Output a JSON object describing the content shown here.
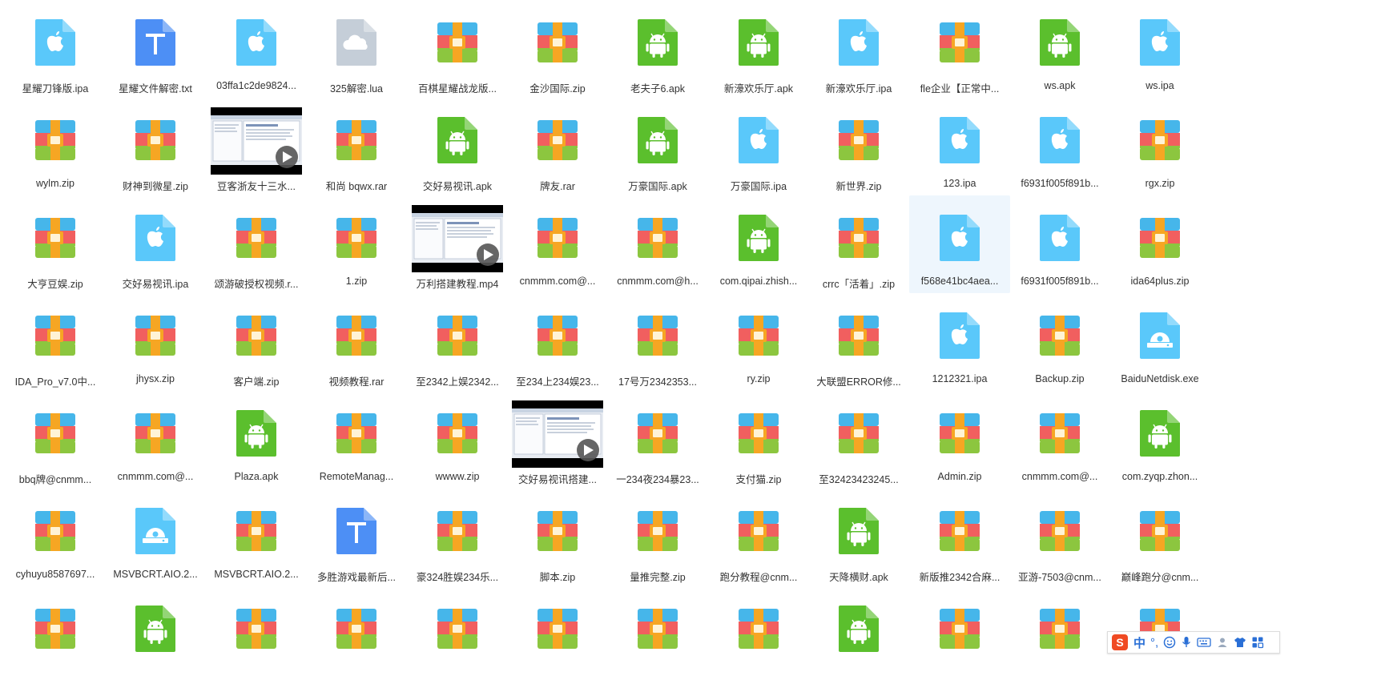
{
  "files": [
    {
      "name": "星耀刀锋版.ipa",
      "type": "ipa"
    },
    {
      "name": "星耀文件解密.txt",
      "type": "txt"
    },
    {
      "name": "03ffa1c2de9824",
      "type": "ipa",
      "elided": true
    },
    {
      "name": "325解密.lua",
      "type": "cloud"
    },
    {
      "name": "百棋星耀战龙版",
      "type": "zip",
      "elided": true
    },
    {
      "name": "金沙国际.zip",
      "type": "zip"
    },
    {
      "name": "老夫子6.apk",
      "type": "apk"
    },
    {
      "name": "新濠欢乐厅.apk",
      "type": "apk"
    },
    {
      "name": "新濠欢乐厅.ipa",
      "type": "ipa"
    },
    {
      "name": "fle企业【正常中",
      "type": "zip",
      "elided": true
    },
    {
      "name": "ws.apk",
      "type": "apk"
    },
    {
      "name": "ws.ipa",
      "type": "ipa"
    },
    {
      "name": "wylm.zip",
      "type": "zip"
    },
    {
      "name": "财神到微星.zip",
      "type": "zip"
    },
    {
      "name": "豆客浙友十三水",
      "type": "video",
      "elided": true
    },
    {
      "name": "和尚 bqwx.rar",
      "type": "zip"
    },
    {
      "name": "交好易视讯.apk",
      "type": "apk"
    },
    {
      "name": "牌友.rar",
      "type": "zip"
    },
    {
      "name": "万豪国际.apk",
      "type": "apk"
    },
    {
      "name": "万豪国际.ipa",
      "type": "ipa"
    },
    {
      "name": "新世界.zip",
      "type": "zip"
    },
    {
      "name": "123.ipa",
      "type": "ipa"
    },
    {
      "name": "f6931f005f891b",
      "type": "ipa",
      "elided": true
    },
    {
      "name": "rgx.zip",
      "type": "zip"
    },
    {
      "name": "大亨豆娱.zip",
      "type": "zip"
    },
    {
      "name": "交好易视讯.ipa",
      "type": "ipa"
    },
    {
      "name": "颂游破授权视频.r",
      "type": "zip",
      "elided": true
    },
    {
      "name": "1.zip",
      "type": "zip"
    },
    {
      "name": "万利搭建教程.mp4",
      "type": "video"
    },
    {
      "name": "cnmmm.com@",
      "type": "zip",
      "elided": true
    },
    {
      "name": "cnmmm.com@h",
      "type": "zip",
      "elided": true
    },
    {
      "name": "com.qipai.zhish",
      "type": "apk",
      "elided": true
    },
    {
      "name": "crrc「活着」.zip",
      "type": "zip"
    },
    {
      "name": "f568e41bc4aea",
      "type": "ipa",
      "elided": true,
      "selected": true
    },
    {
      "name": "f6931f005f891b",
      "type": "ipa",
      "elided": true
    },
    {
      "name": "ida64plus.zip",
      "type": "zip"
    },
    {
      "name": "IDA_Pro_v7.0中",
      "type": "zip",
      "elided": true
    },
    {
      "name": "jhysx.zip",
      "type": "zip"
    },
    {
      "name": "客户端.zip",
      "type": "zip"
    },
    {
      "name": "视频教程.rar",
      "type": "zip"
    },
    {
      "name": "至2342上娱2342",
      "type": "zip",
      "elided": true
    },
    {
      "name": "至234上234娱23",
      "type": "zip",
      "elided": true
    },
    {
      "name": "17号万2342353",
      "type": "zip",
      "elided": true
    },
    {
      "name": "ry.zip",
      "type": "zip"
    },
    {
      "name": "大联盟ERROR修",
      "type": "zip",
      "elided": true
    },
    {
      "name": "1212321.ipa",
      "type": "ipa"
    },
    {
      "name": "Backup.zip",
      "type": "zip"
    },
    {
      "name": "BaiduNetdisk.exe",
      "type": "exe"
    },
    {
      "name": "bbq牌@cnmm",
      "type": "zip",
      "elided": true
    },
    {
      "name": "cnmmm.com@",
      "type": "zip",
      "elided": true
    },
    {
      "name": "Plaza.apk",
      "type": "apk"
    },
    {
      "name": "RemoteManag",
      "type": "zip",
      "elided": true
    },
    {
      "name": "wwww.zip",
      "type": "zip"
    },
    {
      "name": "交好易视讯搭建",
      "type": "video",
      "elided": true
    },
    {
      "name": "一234夜234暴23",
      "type": "zip",
      "elided": true
    },
    {
      "name": "支付猫.zip",
      "type": "zip"
    },
    {
      "name": "至32423423245",
      "type": "zip",
      "elided": true
    },
    {
      "name": "Admin.zip",
      "type": "zip"
    },
    {
      "name": "cnmmm.com@",
      "type": "zip",
      "elided": true
    },
    {
      "name": "com.zyqp.zhon",
      "type": "apk",
      "elided": true
    },
    {
      "name": "cyhuyu8587697",
      "type": "zip",
      "elided": true
    },
    {
      "name": "MSVBCRT.AIO.2",
      "type": "exe",
      "elided": true
    },
    {
      "name": "MSVBCRT.AIO.2",
      "type": "zip",
      "elided": true
    },
    {
      "name": "多胜游戏最新后",
      "type": "txt",
      "elided": true
    },
    {
      "name": "豪324胜娱234乐",
      "type": "zip",
      "elided": true
    },
    {
      "name": "脚本.zip",
      "type": "zip"
    },
    {
      "name": "量推完整.zip",
      "type": "zip"
    },
    {
      "name": "跑分教程@cnm",
      "type": "zip",
      "elided": true
    },
    {
      "name": "天降横财.apk",
      "type": "apk"
    },
    {
      "name": "新版推2342合麻",
      "type": "zip",
      "elided": true
    },
    {
      "name": "亚游-7503@cnm",
      "type": "zip",
      "elided": true
    },
    {
      "name": "巅峰跑分@cnm",
      "type": "zip",
      "elided": true
    },
    {
      "name": "",
      "type": "zip"
    },
    {
      "name": "",
      "type": "apk"
    },
    {
      "name": "",
      "type": "zip"
    },
    {
      "name": "",
      "type": "zip"
    },
    {
      "name": "",
      "type": "zip"
    },
    {
      "name": "",
      "type": "zip"
    },
    {
      "name": "",
      "type": "zip"
    },
    {
      "name": "",
      "type": "zip"
    },
    {
      "name": "",
      "type": "apk"
    },
    {
      "name": "",
      "type": "zip"
    },
    {
      "name": "",
      "type": "zip"
    },
    {
      "name": "",
      "type": "zip"
    }
  ],
  "ime": {
    "lang_label": "中",
    "punct_label": "°,",
    "items": [
      "sogou-logo-icon",
      "lang-indicator",
      "punctuation-icon",
      "emoji-icon",
      "microphone-icon",
      "keyboard-icon",
      "user-icon",
      "skin-icon",
      "toolbox-icon"
    ]
  },
  "colors": {
    "ipa": "#5ac8fa",
    "apk": "#5bbf2d",
    "txt": "#4d8ff5",
    "cloud": "#c5ced8",
    "exe": "#5ac8fa",
    "zip_top": "#46b6ea",
    "zip_mid": "#f15f5f",
    "zip_bot": "#8cc63f",
    "zip_band": "#f6a623",
    "selected_bg": "#eef6fd"
  }
}
